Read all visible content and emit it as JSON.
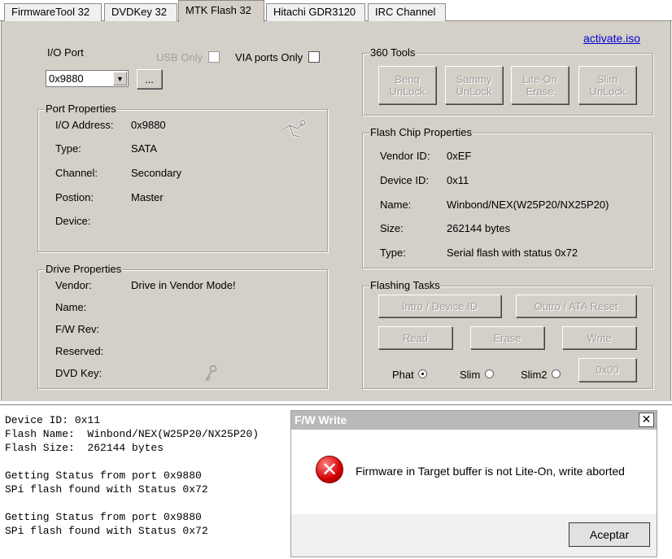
{
  "tabs": [
    {
      "label": "FirmwareTool 32"
    },
    {
      "label": "DVDKey 32"
    },
    {
      "label": "MTK Flash 32"
    },
    {
      "label": "Hitachi GDR3120"
    },
    {
      "label": "IRC Channel"
    }
  ],
  "io_port": {
    "label": "I/O Port",
    "value": "0x9880",
    "browse_label": "...",
    "usb_only_label": "USB Only",
    "via_only_label": "VIA ports Only"
  },
  "activate_link": "activate.iso",
  "port_properties": {
    "title": "Port Properties",
    "rows": [
      {
        "label": "I/O Address:",
        "value": "0x9880"
      },
      {
        "label": "Type:",
        "value": "SATA"
      },
      {
        "label": "Channel:",
        "value": "Secondary"
      },
      {
        "label": "Postion:",
        "value": "Master"
      },
      {
        "label": "Device:",
        "value": ""
      }
    ]
  },
  "drive_properties": {
    "title": "Drive Properties",
    "rows": [
      {
        "label": "Vendor:",
        "value": "Drive in Vendor Mode!"
      },
      {
        "label": "Name:",
        "value": ""
      },
      {
        "label": "F/W Rev:",
        "value": ""
      },
      {
        "label": "Reserved:",
        "value": ""
      },
      {
        "label": "DVD Key:",
        "value": ""
      }
    ]
  },
  "tools_360": {
    "title": "360 Tools",
    "buttons": [
      {
        "line1": "Benq",
        "line2": "UnLock"
      },
      {
        "line1": "Sammy",
        "line2": "UnLock"
      },
      {
        "line1": "Lite-On",
        "line2": "Erase"
      },
      {
        "line1": "Slim",
        "line2": "UnLock"
      }
    ]
  },
  "flash_chip": {
    "title": "Flash Chip Properties",
    "rows": [
      {
        "label": "Vendor ID:",
        "value": "0xEF"
      },
      {
        "label": "Device ID:",
        "value": "0x11"
      },
      {
        "label": "Name:",
        "value": "Winbond/NEX(W25P20/NX25P20)"
      },
      {
        "label": "Size:",
        "value": "262144 bytes"
      },
      {
        "label": "Type:",
        "value": "Serial flash with status 0x72"
      }
    ]
  },
  "flashing_tasks": {
    "title": "Flashing Tasks",
    "intro_label": "Intro / Device ID",
    "outro_label": "Outro / ATA Reset",
    "read_label": "Read",
    "erase_label": "Erase",
    "write_label": "Write",
    "radios": [
      {
        "label": "Phat",
        "selected": true
      },
      {
        "label": "Slim",
        "selected": false
      },
      {
        "label": "Slim2",
        "selected": false
      }
    ],
    "hex_button_label": "0x00"
  },
  "log": {
    "lines": [
      "Device ID: 0x11",
      "Flash Name:  Winbond/NEX(W25P20/NX25P20)",
      "Flash Size:  262144 bytes",
      "",
      "Getting Status from port 0x9880",
      "SPi flash found with Status 0x72",
      "",
      "Getting Status from port 0x9880",
      "SPi flash found with Status 0x72"
    ]
  },
  "dialog": {
    "title": "F/W Write",
    "message": "Firmware in Target buffer is not Lite-On, write aborted",
    "ok_label": "Aceptar",
    "close_glyph": "✕",
    "icon": "error-icon"
  },
  "colors": {
    "panel": "#d4d0c8",
    "link": "#0000cc",
    "dialog_title_bar": "#b9b9b9",
    "error_red": "#d00000"
  }
}
